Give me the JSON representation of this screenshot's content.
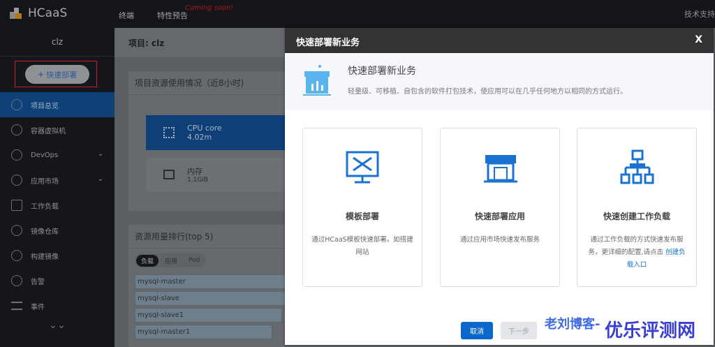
{
  "topbar": {
    "brand": "HCaaS",
    "nav": [
      "终端",
      "特性预告"
    ],
    "coming": "Coming soon!",
    "support": "技术支持"
  },
  "sidebar": {
    "project": "clz",
    "quick_deploy": "快速部署",
    "items": [
      {
        "label": "项目总览",
        "active": true
      },
      {
        "label": "容器虚拟机"
      },
      {
        "label": "DevOps",
        "expandable": true
      },
      {
        "label": "应用市场",
        "expandable": true
      },
      {
        "label": "工作负载"
      },
      {
        "label": "镜像仓库"
      },
      {
        "label": "构建镜像"
      },
      {
        "label": "告警"
      },
      {
        "label": "事件"
      }
    ]
  },
  "main": {
    "title": "项目: clz",
    "usage_title": "项目资源使用情况（近8小时)",
    "cpu_label": "CPU core",
    "cpu_value": "4.02m",
    "mem_label": "内存",
    "mem_value": "1.1GiB",
    "rank_title": "资源用量排行(top 5)",
    "tabs": [
      "负载",
      "应用",
      "Pod"
    ],
    "rows": [
      "mysql-master",
      "mysql-slave",
      "mysql-slave1",
      "mysql-master1"
    ]
  },
  "modal": {
    "title": "快速部署新业务",
    "close": "X",
    "banner_title": "快速部署新业务",
    "banner_desc": "轻量级、可移植、自包含的软件打包技术，使应用可以在几乎任何地方以相同的方式运行。",
    "cards": [
      {
        "title": "模板部署",
        "desc": "通过HCaaS模板快速部署。如搭建网站"
      },
      {
        "title": "快速部署应用",
        "desc": "通过应用市场快速发布服务"
      },
      {
        "title": "快速创建工作负载",
        "desc": "通过工作负载的方式快速发布服务，更详细的配置,请点击",
        "link": "创建负载入口"
      }
    ],
    "cancel": "取消",
    "next": "下一步"
  },
  "watermark": {
    "a": "老刘博客-",
    "b": "优乐评测网"
  },
  "colors": {
    "accent": "#0b67cc",
    "header": "#333333"
  }
}
